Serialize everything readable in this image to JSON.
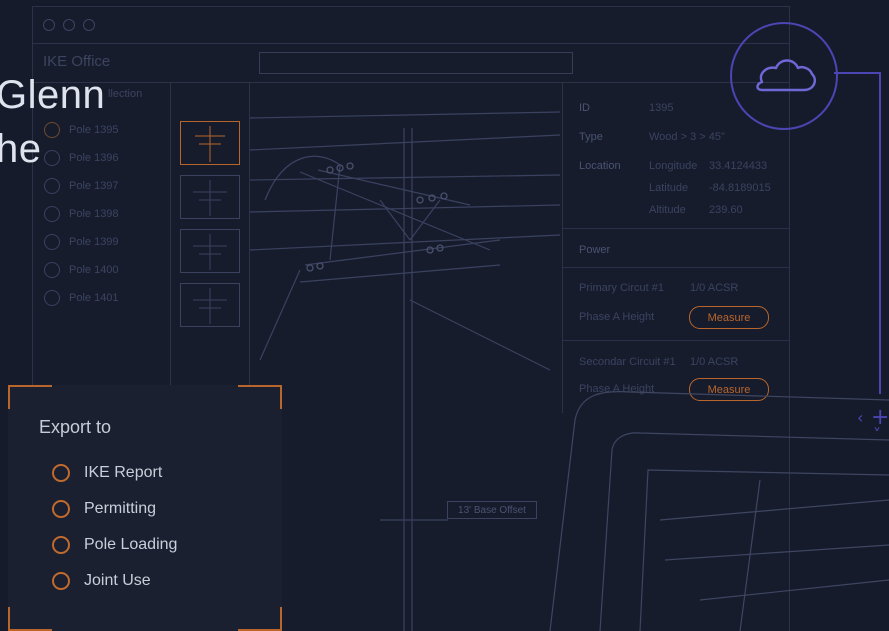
{
  "window": {
    "app_name": "IKE Office"
  },
  "collection": {
    "title": "llection",
    "poles": [
      "Pole 1395",
      "Pole 1396",
      "Pole 1397",
      "Pole 1398",
      "Pole 1399",
      "Pole 1400",
      "Pole 1401"
    ]
  },
  "info": {
    "id_label": "ID",
    "id_value": "1395",
    "type_label": "Type",
    "type_value": "Wood > 3 > 45\"",
    "location_label": "Location",
    "longitude_label": "Longitude",
    "longitude_value": "33.4124433",
    "latitude_label": "Latitude",
    "latitude_value": "-84.8189015",
    "altitude_label": "Altitude",
    "altitude_value": "239.60",
    "power_label": "Power",
    "primary_label": "Primary Circut #1",
    "primary_value": "1/0 ACSR",
    "phase_a_label_1": "Phase A Height",
    "measure_label_1": "Measure",
    "secondary_label": "Secondar Circuit #1",
    "secondary_value": "1/0 ACSR",
    "phase_a_label_2": "Phase A Height",
    "measure_label_2": "Measure"
  },
  "diagram": {
    "offset_label": "13' Base Offset"
  },
  "headline": {
    "line1": "Glenn",
    "line2": "he"
  },
  "export": {
    "title": "Export to",
    "options": [
      "IKE Report",
      "Permitting",
      "Pole Loading",
      "Joint Use"
    ]
  },
  "icons": {
    "cloud": "cloud-icon",
    "nav": "crosshair-arrows-icon"
  },
  "colors": {
    "accent_orange": "#b8662b",
    "accent_purple": "#4b46b3",
    "background": "#161b2b"
  }
}
